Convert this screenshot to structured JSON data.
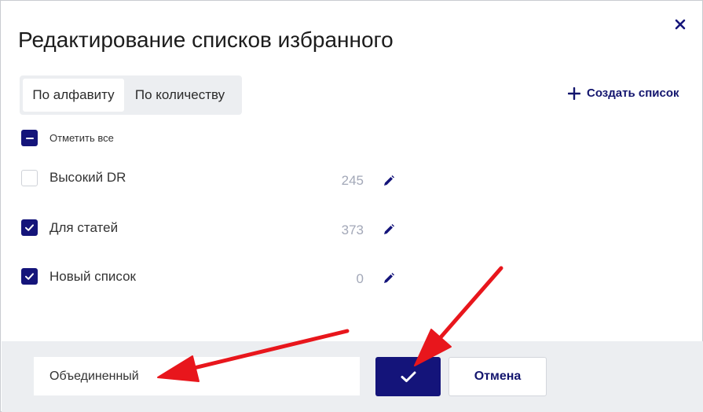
{
  "dialog": {
    "title": "Редактирование списков избранного"
  },
  "sort_tabs": [
    {
      "label": "По алфавиту",
      "active": true
    },
    {
      "label": "По количеству",
      "active": false
    }
  ],
  "create_list": {
    "label": "Создать список",
    "icon": "plus-icon"
  },
  "select_all": {
    "label": "Отметить все",
    "state": "indeterminate"
  },
  "lists": [
    {
      "name": "Высокий DR",
      "count": "245",
      "checked": false
    },
    {
      "name": "Для статей",
      "count": "373",
      "checked": true
    },
    {
      "name": "Новый список",
      "count": "0",
      "checked": true
    }
  ],
  "footer": {
    "name_input_value": "Объединенный",
    "confirm_icon": "check-icon",
    "cancel_label": "Отмена"
  },
  "colors": {
    "accent": "#14147a",
    "annotation_arrow": "#e8161c",
    "footer_bg": "#eceef1",
    "count_text": "#a3a8b8"
  }
}
